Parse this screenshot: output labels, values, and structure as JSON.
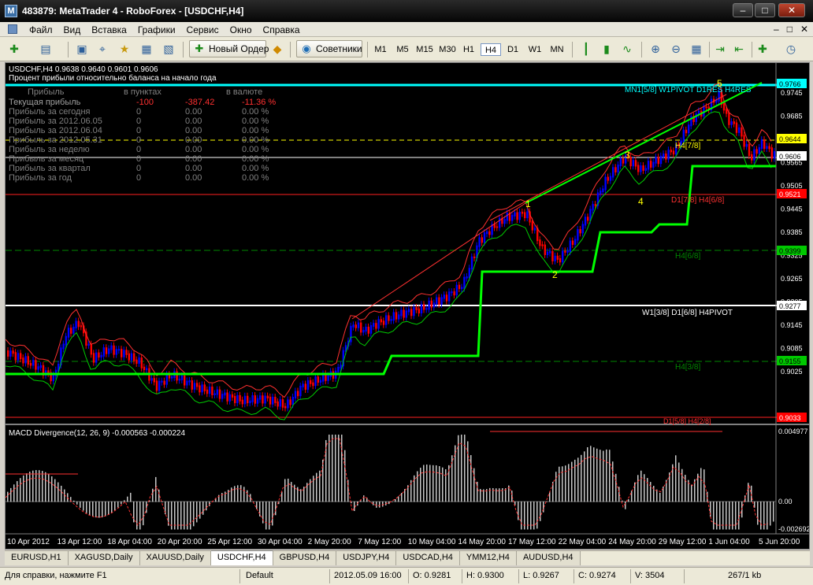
{
  "window": {
    "title": "483879: MetaTrader 4 - RoboForex - [USDCHF,H4]",
    "min_glyph": "–",
    "max_glyph": "□",
    "close_glyph": "✕"
  },
  "menu": {
    "items": [
      "Файл",
      "Вид",
      "Вставка",
      "Графики",
      "Сервис",
      "Окно",
      "Справка"
    ],
    "right_glyphs": [
      "–",
      "□",
      "✕"
    ]
  },
  "toolbar": {
    "new_order": "Новый Ордер",
    "advisors": "Советники",
    "timeframes": [
      "M1",
      "M5",
      "M15",
      "M30",
      "H1",
      "H4",
      "D1",
      "W1",
      "MN"
    ],
    "active_timeframe": "H4"
  },
  "chart": {
    "header": "USDCHF,H4  0.9638 0.9640 0.9601 0.9606",
    "subheader": "Процент прибыли относительно баланса на начало года",
    "table_headers": [
      "Прибыль",
      "в пунктах",
      "в валюте"
    ],
    "table_rows": [
      {
        "label": "Текущая прибыль",
        "points": "-100",
        "money": "-387.42",
        "pct": "-11.36 %"
      },
      {
        "label": "Прибыль за сегодня",
        "points": "0",
        "money": "0.00",
        "pct": "0.00 %"
      },
      {
        "label": "Прибыль за 2012.06.05",
        "points": "0",
        "money": "0.00",
        "pct": "0.00 %"
      },
      {
        "label": "Прибыль за 2012.06.04",
        "points": "0",
        "money": "0.00",
        "pct": "0.00 %"
      },
      {
        "label": "Прибыль за 2012.05.31",
        "points": "0",
        "money": "0.00",
        "pct": "0.00 %"
      },
      {
        "label": "Прибыль за неделю",
        "points": "0",
        "money": "0.00",
        "pct": "0.00 %"
      },
      {
        "label": "Прибыль за месяц",
        "points": "0",
        "money": "0.00",
        "pct": "0.00 %"
      },
      {
        "label": "Прибыль за квартал",
        "points": "0",
        "money": "0.00",
        "pct": "0.00 %"
      },
      {
        "label": "Прибыль за год",
        "points": "0",
        "money": "0.00",
        "pct": "0.00 %"
      }
    ],
    "price_scale": [
      "0.9745",
      "0.9685",
      "0.9625",
      "0.9565",
      "0.9505",
      "0.9445",
      "0.9385",
      "0.9325",
      "0.9265",
      "0.9205",
      "0.9145",
      "0.9085",
      "0.9025"
    ],
    "price_tags": [
      {
        "price": "0.9766",
        "color": "#00ffff",
        "text_color": "#000000"
      },
      {
        "price": "0.9644",
        "color": "#ffff00",
        "text_color": "#000000"
      },
      {
        "price": "0.9606",
        "color": "#ffffff",
        "text_color": "#000000"
      },
      {
        "price": "0.9521",
        "color": "#ff0000",
        "text_color": "#ffffff"
      },
      {
        "price": "0.9399",
        "color": "#00c800",
        "text_color": "#000000"
      },
      {
        "price": "0.9277",
        "color": "#ffffff",
        "text_color": "#000000"
      },
      {
        "price": "0.9155",
        "color": "#00c800",
        "text_color": "#000000"
      },
      {
        "price": "0.9033",
        "color": "#ff0000",
        "text_color": "#ffffff"
      }
    ],
    "level_labels": {
      "top": "MN1[5/8] W1PIVOT D1RES H4RES",
      "h4_78": "H4[7/8]",
      "red_78": "D1[7/8] H4[6/8]",
      "green_68": "H4[6/8]",
      "mid": "W1[3/8] D1[6/8] H4PIVOT",
      "green_38": "H4[3/8]",
      "bottom": "D1[5/8] H4[2/8]"
    },
    "wave_labels": [
      "1",
      "2",
      "3",
      "4",
      "5"
    ],
    "macd_header": "MACD Divergence(12, 26, 9) -0.000563 -0.000224",
    "macd_scale": [
      "0.004977",
      "0.00",
      "-0.002692"
    ],
    "time_axis": [
      "10 Apr 2012",
      "13 Apr 12:00",
      "18 Apr 04:00",
      "20 Apr 20:00",
      "25 Apr 12:00",
      "30 Apr 04:00",
      "2 May 20:00",
      "7 May 12:00",
      "10 May 04:00",
      "14 May 20:00",
      "17 May 12:00",
      "22 May 04:00",
      "24 May 20:00",
      "29 May 12:00",
      "1 Jun 04:00",
      "5 Jun 20:00"
    ]
  },
  "tabs": [
    "EURUSD,H1",
    "XAGUSD,Daily",
    "XAUUSD,Daily",
    "USDCHF,H4",
    "GBPUSD,H4",
    "USDJPY,H4",
    "USDCAD,H4",
    "YMM12,H4",
    "AUDUSD,H4"
  ],
  "active_tab": "USDCHF,H4",
  "status": {
    "help": "Для справки, нажмите F1",
    "profile": "Default",
    "datetime": "2012.05.09 16:00",
    "open": "O: 0.9281",
    "high": "H: 0.9300",
    "low": "L: 0.9267",
    "close": "C: 0.9274",
    "volume": "V: 3504",
    "traffic": "267/1 kb"
  },
  "colors": {
    "up_candle": "#0000ff",
    "down_candle": "#ff0000",
    "trend_green": "#00ff00",
    "magenta_level": "#ff00ff",
    "cyan_level": "#00ffff"
  }
}
